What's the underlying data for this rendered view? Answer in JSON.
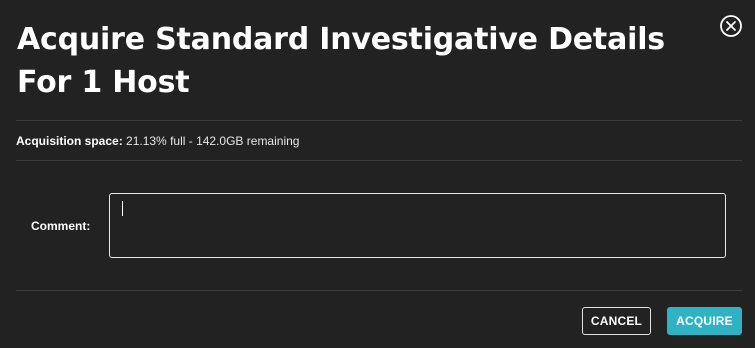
{
  "dialog": {
    "title": "Acquire Standard Investigative Details For 1 Host",
    "close_icon": "close-circle-icon"
  },
  "acquisition_space": {
    "label": "Acquisition space:",
    "value": "21.13% full - 142.0GB remaining"
  },
  "comment": {
    "label": "Comment:",
    "value": "",
    "placeholder": ""
  },
  "actions": {
    "cancel_label": "CANCEL",
    "acquire_label": "ACQUIRE"
  },
  "colors": {
    "background": "#222222",
    "accent": "#2fb3c4",
    "text": "#ffffff",
    "divider": "#3d3d3d"
  }
}
